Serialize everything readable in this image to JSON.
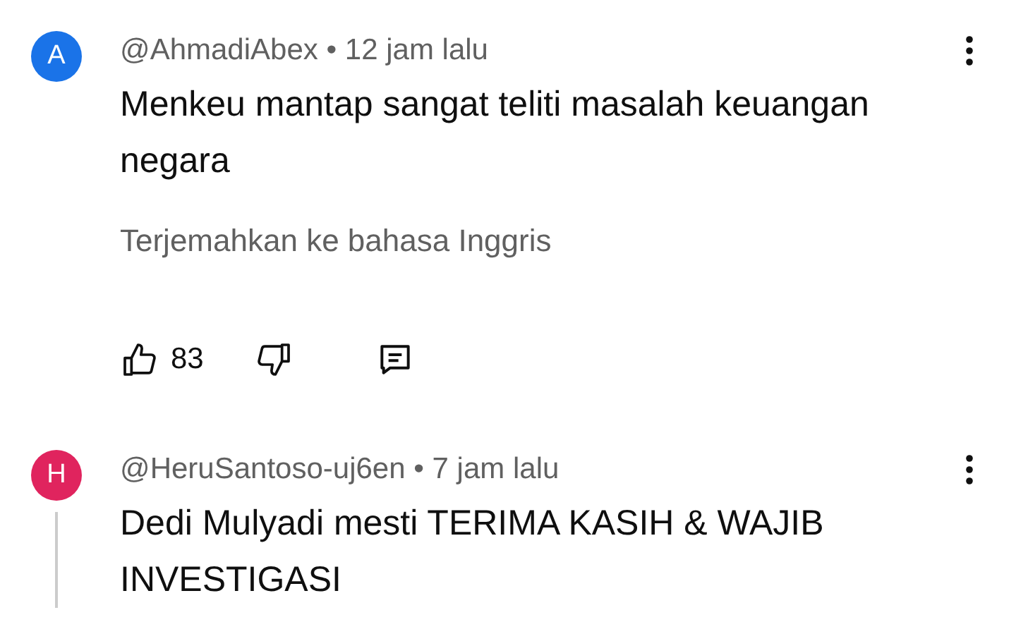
{
  "comments": [
    {
      "avatar_letter": "A",
      "color": "#1a73e8",
      "meta": "@AhmadiAbex • 12 jam lalu",
      "body": "Menkeu mantap sangat teliti masalah keuangan negara",
      "translate": "Terjemahkan ke bahasa Inggris",
      "likes": "83",
      "has_replies": false
    },
    {
      "avatar_letter": "H",
      "color": "#e0245e",
      "meta": "@HeruSantoso-uj6en • 7 jam lalu",
      "body": "Dedi Mulyadi mesti TERIMA KASIH & WAJIB INVESTIGASI",
      "has_replies": true
    }
  ]
}
